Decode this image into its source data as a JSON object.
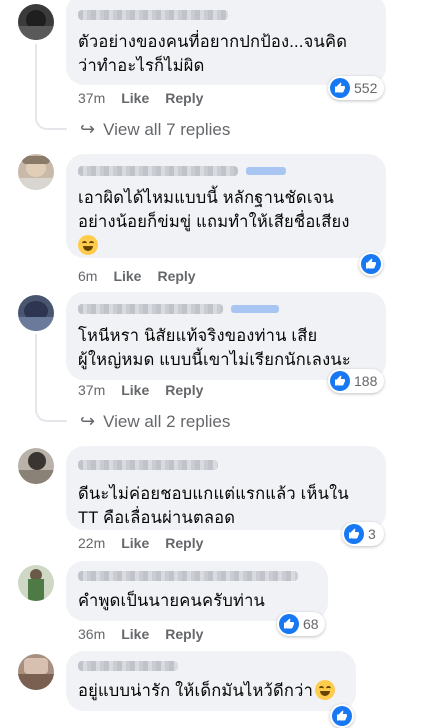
{
  "comments": [
    {
      "text": "ตัวอย่างของคนที่อยากปกป้อง...จนคิด\nว่าทำอะไรก็ไม่ผิด",
      "time": "37m",
      "like": "Like",
      "reply": "Reply",
      "reaction_count": "552",
      "view_replies": "View all 7 replies"
    },
    {
      "text": "เอาผิดได้ไหมแบบนี้ หลักฐานชัดเจน\nอย่างน้อยก็ข่มขู่ แถมทำให้เสียชื่อเสียง",
      "time": "6m",
      "like": "Like",
      "reply": "Reply",
      "reaction_count": ""
    },
    {
      "text": "โหนีหรา นิสัยแท้จริงของท่าน เสีย\nผู้ใหญ่หมด แบบนี้เขาไม่เรียกนักเลงนะ",
      "time": "37m",
      "like": "Like",
      "reply": "Reply",
      "reaction_count": "188",
      "view_replies": "View all 2 replies"
    },
    {
      "text": "ดีนะไม่ค่อยชอบแกแต่แรกแล้ว เห็นใน\nTT คือเลื่อนผ่านตลอด",
      "time": "22m",
      "like": "Like",
      "reply": "Reply",
      "reaction_count": "3"
    },
    {
      "text": "คำพูดเป็นนายคนครับท่าน",
      "time": "36m",
      "like": "Like",
      "reply": "Reply",
      "reaction_count": "68"
    },
    {
      "text": "อยู่แบบน่ารัก ให้เด็กมันไหว้ดีกว่า",
      "time": "",
      "like": "",
      "reply": "",
      "reaction_count": ""
    }
  ],
  "colors": {
    "bubble": "#f0f2f5",
    "like_blue": "#1877f2",
    "meta_gray": "#65676b"
  },
  "icons": {
    "like": "thumbs-up-icon",
    "reply_arrow": "reply-arrow-icon",
    "emoji_grin": "grinning-emoji-icon",
    "emoji_sweat": "sweat-smile-emoji-icon"
  }
}
